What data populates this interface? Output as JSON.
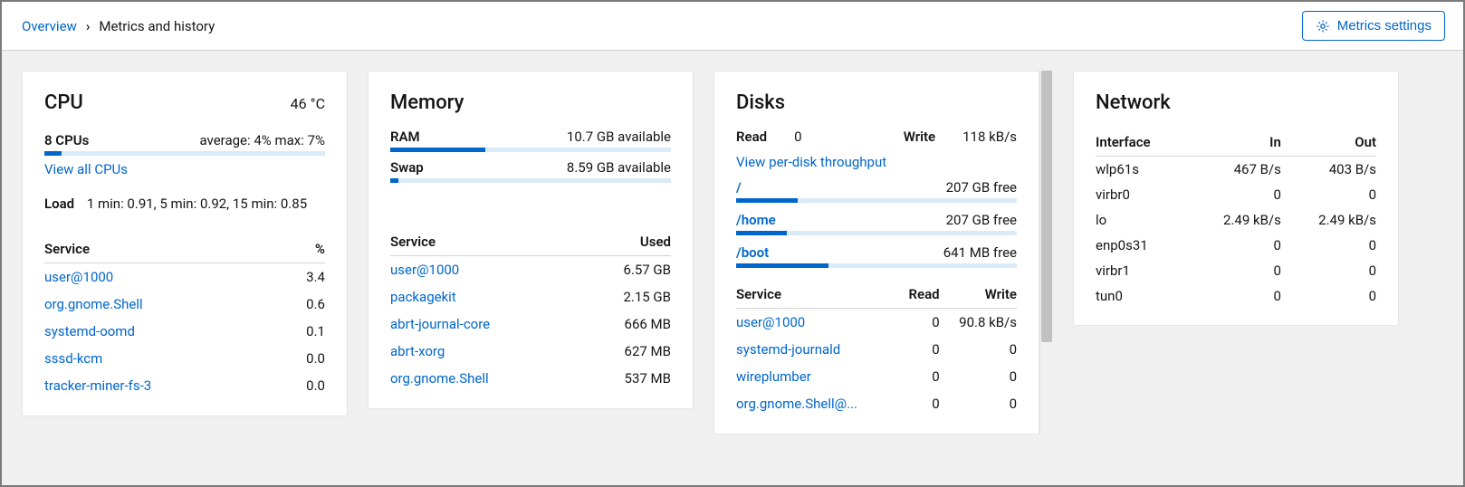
{
  "breadcrumb": {
    "overview": "Overview",
    "current": "Metrics and history"
  },
  "settings_button": "Metrics settings",
  "cpu": {
    "title": "CPU",
    "temp": "46 °C",
    "count_label": "8 CPUs",
    "avg_max": "average: 4% max: 7%",
    "view_all": "View all CPUs",
    "load_label": "Load",
    "load_values": "1 min: 0.91, 5 min: 0.92, 15 min: 0.85",
    "table": {
      "h1": "Service",
      "h2": "%",
      "rows": [
        {
          "name": "user@1000",
          "val": "3.4"
        },
        {
          "name": "org.gnome.Shell",
          "val": "0.6"
        },
        {
          "name": "systemd-oomd",
          "val": "0.1"
        },
        {
          "name": "sssd-kcm",
          "val": "0.0"
        },
        {
          "name": "tracker-miner-fs-3",
          "val": "0.0"
        }
      ]
    }
  },
  "memory": {
    "title": "Memory",
    "ram_label": "RAM",
    "ram_avail": "10.7 GB available",
    "swap_label": "Swap",
    "swap_avail": "8.59 GB available",
    "table": {
      "h1": "Service",
      "h2": "Used",
      "rows": [
        {
          "name": "user@1000",
          "val": "6.57 GB"
        },
        {
          "name": "packagekit",
          "val": "2.15 GB"
        },
        {
          "name": "abrt-journal-core",
          "val": "666 MB"
        },
        {
          "name": "abrt-xorg",
          "val": "627 MB"
        },
        {
          "name": "org.gnome.Shell",
          "val": "537 MB"
        }
      ]
    }
  },
  "disks": {
    "title": "Disks",
    "read_label": "Read",
    "read_val": "0",
    "write_label": "Write",
    "write_val": "118 kB/s",
    "view_link": "View per-disk throughput",
    "mounts": [
      {
        "path": "/",
        "free": "207 GB free",
        "pct": 22
      },
      {
        "path": "/home",
        "free": "207 GB free",
        "pct": 18
      },
      {
        "path": "/boot",
        "free": "641 MB free",
        "pct": 33
      }
    ],
    "table": {
      "h1": "Service",
      "h2": "Read",
      "h3": "Write",
      "rows": [
        {
          "name": "user@1000",
          "r": "0",
          "w": "90.8 kB/s"
        },
        {
          "name": "systemd-journald",
          "r": "0",
          "w": "0"
        },
        {
          "name": "wireplumber",
          "r": "0",
          "w": "0"
        },
        {
          "name": "org.gnome.Shell@...",
          "r": "0",
          "w": "0"
        }
      ]
    }
  },
  "network": {
    "title": "Network",
    "h1": "Interface",
    "h2": "In",
    "h3": "Out",
    "rows": [
      {
        "name": "wlp61s",
        "in": "467 B/s",
        "out": "403 B/s"
      },
      {
        "name": "virbr0",
        "in": "0",
        "out": "0"
      },
      {
        "name": "lo",
        "in": "2.49 kB/s",
        "out": "2.49 kB/s"
      },
      {
        "name": "enp0s31",
        "in": "0",
        "out": "0"
      },
      {
        "name": "virbr1",
        "in": "0",
        "out": "0"
      },
      {
        "name": "tun0",
        "in": "0",
        "out": "0"
      }
    ]
  }
}
